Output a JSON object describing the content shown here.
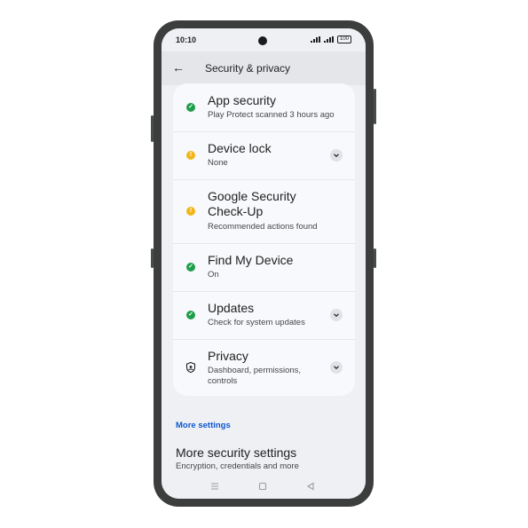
{
  "status_bar": {
    "time": "10:10",
    "battery": "100"
  },
  "header": {
    "title": "Security & privacy"
  },
  "items": [
    {
      "title": "App security",
      "subtitle": "Play Protect scanned 3 hours ago",
      "status": "ok",
      "expandable": false
    },
    {
      "title": "Device lock",
      "subtitle": "None",
      "status": "warning",
      "expandable": true
    },
    {
      "title": "Google Security Check-Up",
      "subtitle": "Recommended actions found",
      "status": "warning",
      "expandable": false
    },
    {
      "title": "Find My Device",
      "subtitle": "On",
      "status": "ok",
      "expandable": false
    },
    {
      "title": "Updates",
      "subtitle": "Check for system updates",
      "status": "ok",
      "expandable": true
    },
    {
      "title": "Privacy",
      "subtitle": "Dashboard, permissions, controls",
      "status": "privacy",
      "expandable": true
    }
  ],
  "more_settings": {
    "section_label": "More settings",
    "title": "More security settings",
    "subtitle": "Encryption, credentials and more"
  },
  "colors": {
    "ok": "#1e9e4a",
    "warning": "#f2b619",
    "accent": "#0b57d0"
  }
}
